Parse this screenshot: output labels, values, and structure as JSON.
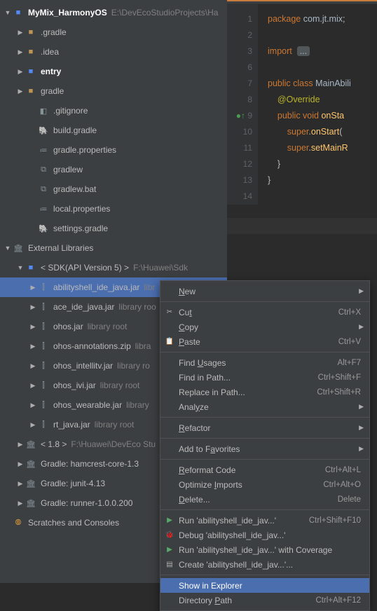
{
  "project": {
    "root": {
      "name": "MyMix_HarmonyOS",
      "path": "E:\\DevEcoStudioProjects\\Ha"
    },
    "nodes": [
      {
        "label": ".gradle",
        "depth": 1,
        "arrow": "▶",
        "iconCls": "folder-icon",
        "iconGlyph": "■"
      },
      {
        "label": ".idea",
        "depth": 1,
        "arrow": "▶",
        "iconCls": "folder-icon",
        "iconGlyph": "■"
      },
      {
        "label": "entry",
        "depth": 1,
        "arrow": "▶",
        "iconCls": "module-icon",
        "iconGlyph": "■",
        "bold": true
      },
      {
        "label": "gradle",
        "depth": 1,
        "arrow": "▶",
        "iconCls": "folder-icon",
        "iconGlyph": "■"
      },
      {
        "label": ".gitignore",
        "depth": 2,
        "arrow": "",
        "iconCls": "file-icon",
        "iconGlyph": "◧"
      },
      {
        "label": "build.gradle",
        "depth": 2,
        "arrow": "",
        "iconCls": "file-icon",
        "iconGlyph": "🐘"
      },
      {
        "label": "gradle.properties",
        "depth": 2,
        "arrow": "",
        "iconCls": "file-icon",
        "iconGlyph": "≔"
      },
      {
        "label": "gradlew",
        "depth": 2,
        "arrow": "",
        "iconCls": "file-icon",
        "iconGlyph": "⧉"
      },
      {
        "label": "gradlew.bat",
        "depth": 2,
        "arrow": "",
        "iconCls": "file-icon",
        "iconGlyph": "⧉"
      },
      {
        "label": "local.properties",
        "depth": 2,
        "arrow": "",
        "iconCls": "file-icon",
        "iconGlyph": "≔"
      },
      {
        "label": "settings.gradle",
        "depth": 2,
        "arrow": "",
        "iconCls": "file-icon",
        "iconGlyph": "🐘"
      }
    ],
    "external_label": "External Libraries",
    "sdk": {
      "label": "< SDK(API Version 5) >",
      "path": "F:\\Huawei\\Sdk"
    },
    "jars": [
      {
        "label": "abilityshell_ide_java.jar",
        "suffix": "libr",
        "selected": true
      },
      {
        "label": "ace_ide_java.jar",
        "suffix": "library roo"
      },
      {
        "label": "ohos.jar",
        "suffix": "library root"
      },
      {
        "label": "ohos-annotations.zip",
        "suffix": "libra"
      },
      {
        "label": "ohos_intellitv.jar",
        "suffix": "library ro"
      },
      {
        "label": "ohos_ivi.jar",
        "suffix": "library root"
      },
      {
        "label": "ohos_wearable.jar",
        "suffix": "library"
      },
      {
        "label": "rt_java.jar",
        "suffix": "library root"
      }
    ],
    "more_libs": [
      {
        "label": "< 1.8 >",
        "path": "F:\\Huawei\\DevEco Stu"
      },
      {
        "label": "Gradle: hamcrest-core-1.3"
      },
      {
        "label": "Gradle: junit-4.13"
      },
      {
        "label": "Gradle: runner-1.0.0.200"
      }
    ],
    "scratches": "Scratches and Consoles"
  },
  "editor": {
    "lines": [
      {
        "n": 1,
        "html": "<span class='kw'>package</span> <span class='id'>com.jt.mix</span>;"
      },
      {
        "n": 2,
        "html": ""
      },
      {
        "n": 3,
        "html": "<span class='kw'>import</span>  <span class='dots'>...</span>"
      },
      {
        "n": 6,
        "html": ""
      },
      {
        "n": 7,
        "html": "<span class='kw'>public class</span> <span class='cls'>MainAbili</span>"
      },
      {
        "n": 8,
        "html": "    <span class='ann'>@Override</span>"
      },
      {
        "n": 9,
        "html": "    <span class='kw'>public void</span> <span class='fn'>onSta</span>",
        "iconRow": true
      },
      {
        "n": 10,
        "html": "        <span class='kw'>super</span>.<span class='fn'>onStart</span>("
      },
      {
        "n": 11,
        "html": "        <span class='kw'>super</span>.<span class='fn'>setMainR</span>"
      },
      {
        "n": 12,
        "html": "    }"
      },
      {
        "n": 13,
        "html": "}"
      },
      {
        "n": 14,
        "html": ""
      }
    ]
  },
  "menu": {
    "groups": [
      [
        {
          "label": "New",
          "sub": true,
          "mnemonic": 0
        }
      ],
      [
        {
          "label": "Cut",
          "shortcut": "Ctrl+X",
          "icon": "✂",
          "mnemonic": 2
        },
        {
          "label": "Copy",
          "sub": true,
          "mnemonic": 0
        },
        {
          "label": "Paste",
          "shortcut": "Ctrl+V",
          "icon": "📋",
          "mnemonic": 0
        }
      ],
      [
        {
          "label": "Find Usages",
          "shortcut": "Alt+F7",
          "mnemonic": 5
        },
        {
          "label": "Find in Path...",
          "shortcut": "Ctrl+Shift+F"
        },
        {
          "label": "Replace in Path...",
          "shortcut": "Ctrl+Shift+R"
        },
        {
          "label": "Analyze",
          "sub": true,
          "mnemonic": 4
        }
      ],
      [
        {
          "label": "Refactor",
          "sub": true,
          "mnemonic": 0
        }
      ],
      [
        {
          "label": "Add to Favorites",
          "sub": true,
          "mnemonic": 8
        }
      ],
      [
        {
          "label": "Reformat Code",
          "shortcut": "Ctrl+Alt+L",
          "mnemonic": 0
        },
        {
          "label": "Optimize Imports",
          "shortcut": "Ctrl+Alt+O",
          "mnemonic": 9
        },
        {
          "label": "Delete...",
          "shortcut": "Delete",
          "mnemonic": 0
        }
      ],
      [
        {
          "label": "Run 'abilityshell_ide_jav...'",
          "shortcut": "Ctrl+Shift+F10",
          "icon": "▶",
          "iconColor": "#59a869"
        },
        {
          "label": "Debug 'abilityshell_ide_jav...'",
          "icon": "🐞",
          "iconColor": "#59a869"
        },
        {
          "label": "Run 'abilityshell_ide_jav...' with Coverage",
          "icon": "▶",
          "iconColor": "#59a869"
        },
        {
          "label": "Create 'abilityshell_ide_jav...'...",
          "icon": "▤"
        }
      ],
      [
        {
          "label": "Show in Explorer",
          "highlighted": true
        },
        {
          "label": "Directory Path",
          "shortcut": "Ctrl+Alt+F12",
          "mnemonic": 10
        }
      ]
    ]
  }
}
